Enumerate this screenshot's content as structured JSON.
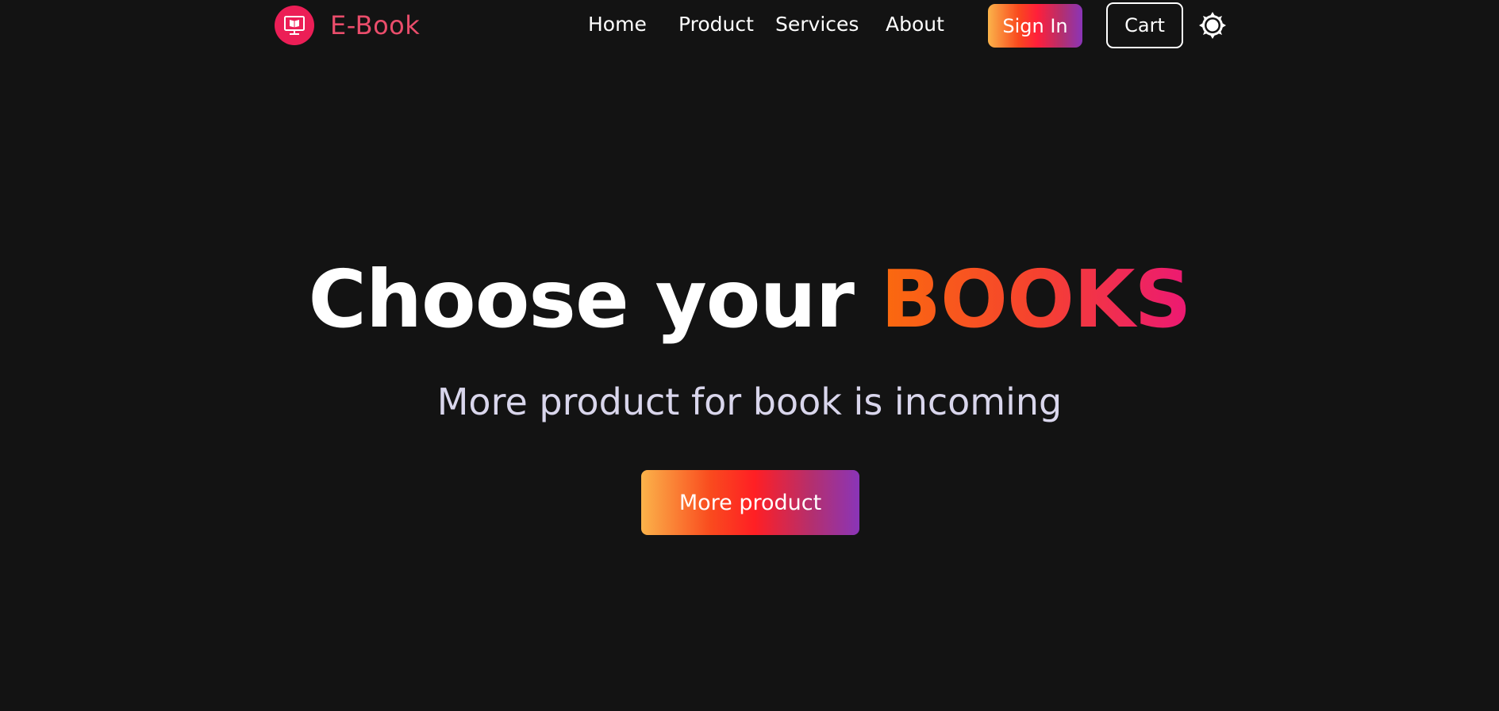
{
  "header": {
    "brand": {
      "name": "E-Book",
      "icon": "monitor-book-icon",
      "icon_bg_color": "#ec1e56",
      "text_color": "#ea4d6b"
    },
    "nav": {
      "home": "Home",
      "product": "Product",
      "services": "Services",
      "about": "About"
    },
    "signin_label": "Sign In",
    "cart_label": "Cart",
    "theme_toggle_icon": "sun-icon"
  },
  "hero": {
    "title_plain": "Choose your ",
    "title_accent": "BOOKS",
    "subtitle": "More product for book is incoming",
    "cta_label": "More product"
  },
  "colors": {
    "background": "#131313",
    "text": "#ffffff",
    "subtitle": "#d9d6ec",
    "gradient_start": "#fbb34a",
    "gradient_mid": "#ff1f24",
    "gradient_end": "#8a35b8"
  }
}
